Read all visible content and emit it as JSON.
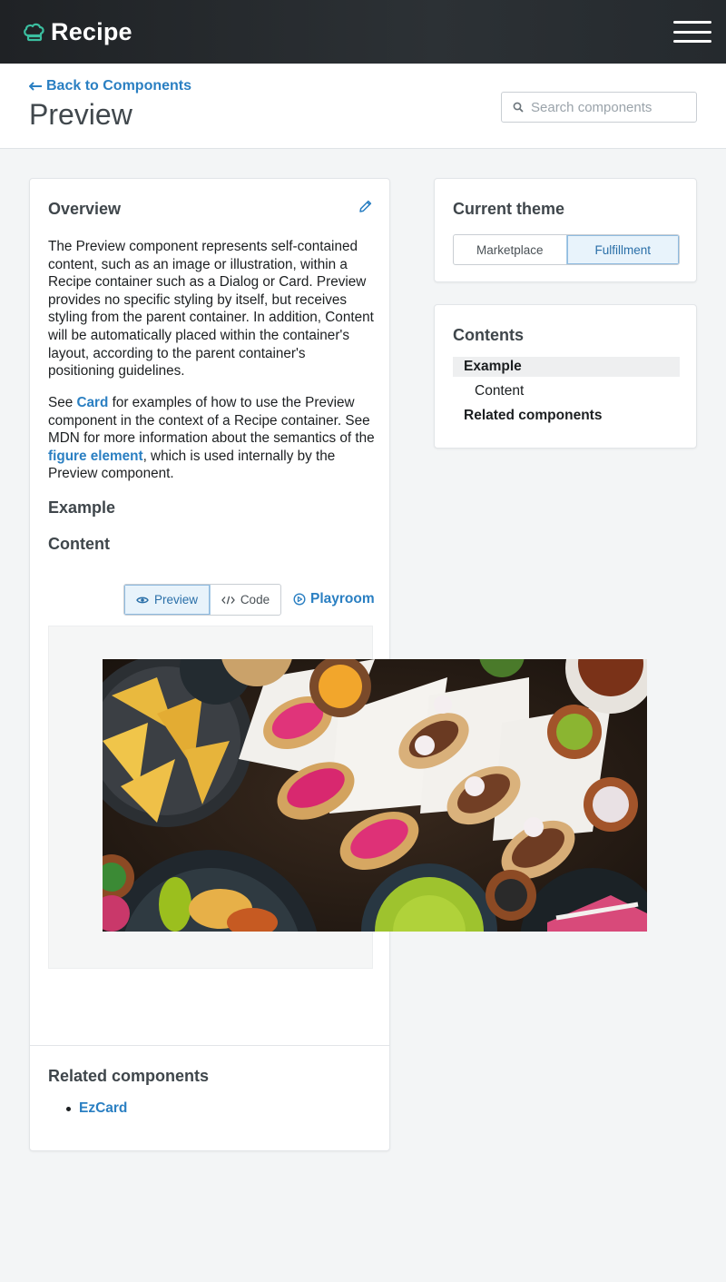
{
  "header": {
    "brand": "Recipe",
    "brand_icon": "chef-hat-icon",
    "menu_icon": "hamburger-menu-icon"
  },
  "page": {
    "back_label": "Back to Components",
    "title": "Preview",
    "search_placeholder": "Search components"
  },
  "overview": {
    "title": "Overview",
    "para1": "The Preview component represents self-contained content, such as an image or illustration, within a Recipe container such as a Dialog or Card. Preview provides no specific styling by itself, but receives styling from the parent container. In addition, Content will be automatically placed within the container's layout, according to the parent container's positioning guidelines.",
    "para2_see": "See",
    "para2_card_link": "Card",
    "para2_mid": "for examples of how to use the Preview component in the context of a Recipe container. See MDN for more information about the semantics of the",
    "para2_figure_link": "figure element",
    "para2_end": ", which is used internally by the Preview component.",
    "example_heading": "Example",
    "content_heading": "Content",
    "toggle_preview": "Preview",
    "toggle_code": "Code",
    "playroom": "Playroom"
  },
  "related": {
    "title": "Related components",
    "items": [
      "EzCard"
    ]
  },
  "theme": {
    "title": "Current theme",
    "options": [
      "Marketplace",
      "Fulfillment"
    ],
    "selected": "Fulfillment"
  },
  "contents": {
    "title": "Contents",
    "items": [
      "Example",
      "Content",
      "Related components"
    ]
  },
  "colors": {
    "accent": "#2a7fc2",
    "brand_icon": "#3bbfa0",
    "header_bg": "#24282b"
  }
}
